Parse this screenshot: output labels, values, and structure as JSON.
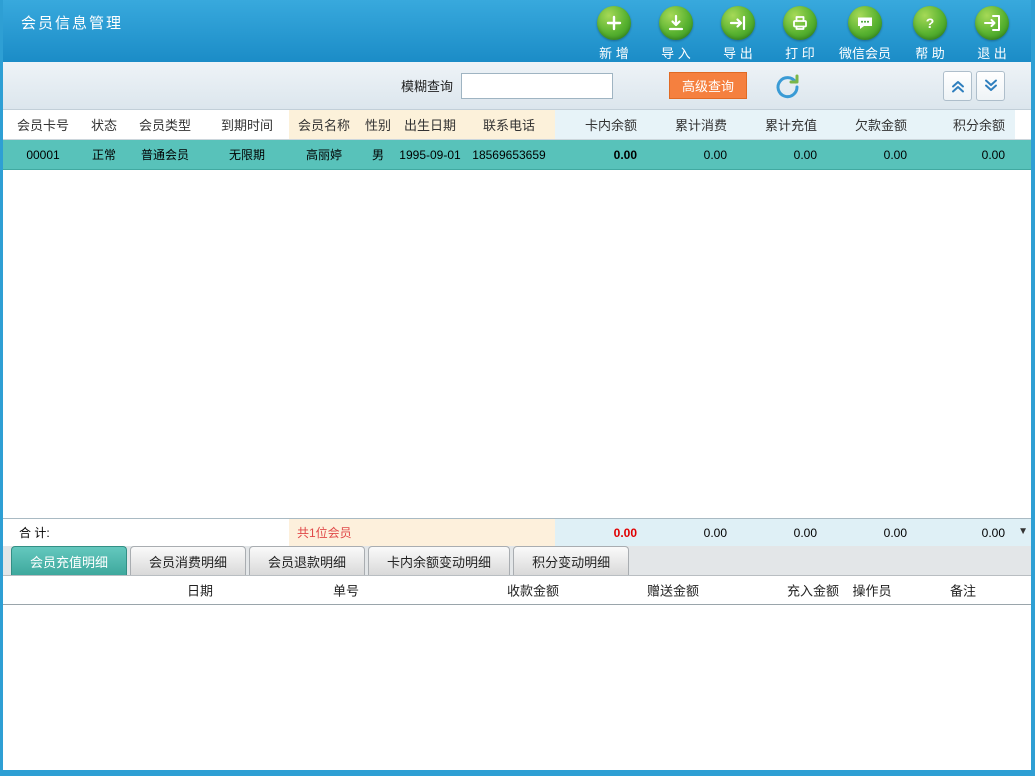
{
  "window": {
    "title": "会员信息管理"
  },
  "toolbar": {
    "buttons": [
      {
        "label": "新 增",
        "icon": "plus-icon"
      },
      {
        "label": "导 入",
        "icon": "import-icon"
      },
      {
        "label": "导 出",
        "icon": "export-icon"
      },
      {
        "label": "打 印",
        "icon": "print-icon"
      },
      {
        "label": "微信会员",
        "icon": "wechat-icon"
      },
      {
        "label": "帮 助",
        "icon": "help-icon"
      },
      {
        "label": "退 出",
        "icon": "exit-icon"
      }
    ]
  },
  "search": {
    "label": "模糊查询",
    "value": "",
    "advanced_button": "高级查询"
  },
  "members_table": {
    "columns": [
      "会员卡号",
      "状态",
      "会员类型",
      "到期时间",
      "会员名称",
      "性别",
      "出生日期",
      "联系电话",
      "卡内余额",
      "累计消费",
      "累计充值",
      "欠款金额",
      "积分余额"
    ],
    "rows": [
      [
        "00001",
        "正常",
        "普通会员",
        "无限期",
        "高丽婷",
        "男",
        "1995-09-01",
        "18569653659",
        "0.00",
        "0.00",
        "0.00",
        "0.00",
        "0.00"
      ]
    ],
    "summary": {
      "label": "合  计:",
      "count_text": "共1位会员",
      "values": [
        "0.00",
        "0.00",
        "0.00",
        "0.00",
        "0.00"
      ]
    }
  },
  "detail_tabs": [
    {
      "label": "会员充值明细",
      "active": true
    },
    {
      "label": "会员消费明细",
      "active": false
    },
    {
      "label": "会员退款明细",
      "active": false
    },
    {
      "label": "卡内余额变动明细",
      "active": false
    },
    {
      "label": "积分变动明细",
      "active": false
    }
  ],
  "detail_table": {
    "columns": [
      "日期",
      "单号",
      "收款金额",
      "赠送金额",
      "充入金额",
      "操作员",
      "备注"
    ]
  },
  "colors": {
    "accent_blue": "#2e9fd4",
    "toolbar_green": "#58b230",
    "selected_row_teal": "#58c2ba",
    "advanced_button_orange": "#f5803f",
    "active_tab_teal": "#3ea89d",
    "cream_highlight": "#fcf1da",
    "summary_red": "#e00000"
  }
}
